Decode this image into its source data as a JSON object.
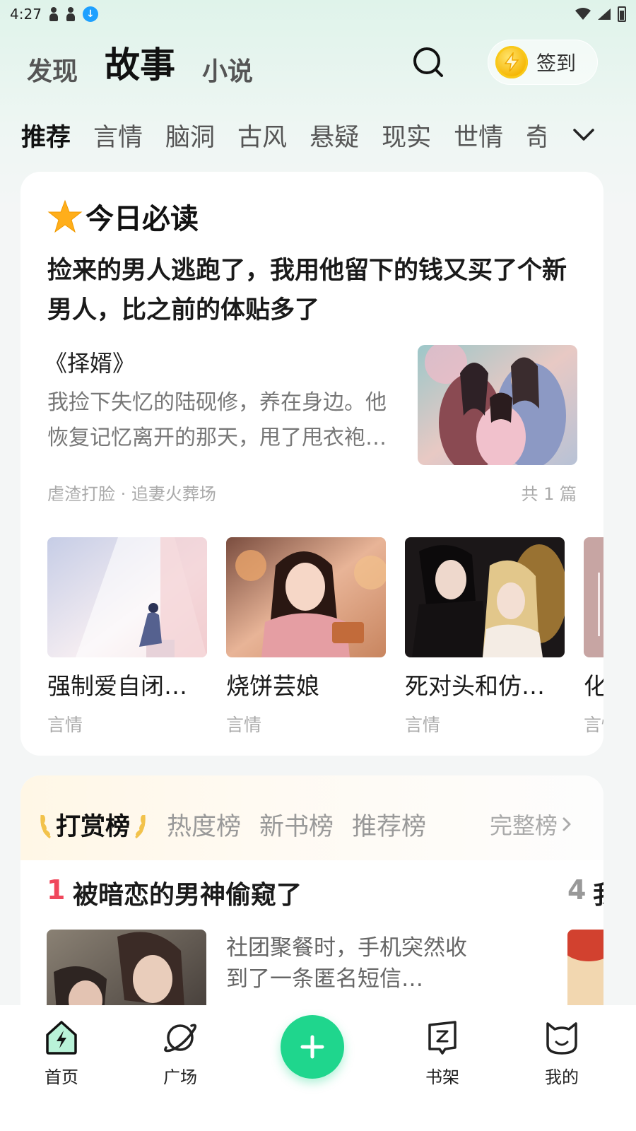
{
  "status_bar": {
    "time": "4:27",
    "download_glyph": "↓"
  },
  "top_nav": {
    "tabs": [
      {
        "label": "发现"
      },
      {
        "label": "故事"
      },
      {
        "label": "小说"
      }
    ],
    "active": 1,
    "checkin_label": "签到"
  },
  "categories": [
    "推荐",
    "言情",
    "脑洞",
    "古风",
    "悬疑",
    "现实",
    "世情",
    "奇幻"
  ],
  "today": {
    "title": "今日必读",
    "headline": "捡来的男人逃跑了，我用他留下的钱又买了个新男人，比之前的体贴多了",
    "book_title": "《择婿》",
    "summary": "我捡下失忆的陆砚修，养在身边。他恢复记忆离开的那天，甩了甩衣袍…",
    "tags": "虐渣打脸 · 追妻火葬场",
    "count": "共 1 篇"
  },
  "recommendations": [
    {
      "title": "强制爱自闭症…",
      "genre": "言情"
    },
    {
      "title": "烧饼芸娘",
      "genre": "言情"
    },
    {
      "title": "死对头和仿生…",
      "genre": "言情"
    },
    {
      "title": "化",
      "genre": "言情"
    }
  ],
  "ranking": {
    "tabs": [
      "打赏榜",
      "热度榜",
      "新书榜",
      "推荐榜"
    ],
    "full_label": "完整榜",
    "items": [
      {
        "rank": "1",
        "title": "被暗恋的男神偷窥了",
        "summary": "社团聚餐时，手机突然收到了一条匿名短信…"
      },
      {
        "rank": "4",
        "title": "我"
      }
    ]
  },
  "bottom_nav": [
    {
      "label": "首页",
      "icon": "home-bolt-icon"
    },
    {
      "label": "广场",
      "icon": "planet-icon"
    },
    {
      "label": "书架",
      "icon": "bookshelf-icon"
    },
    {
      "label": "我的",
      "icon": "profile-cat-icon"
    }
  ],
  "colors": {
    "accent": "#1fd68d",
    "rank_red": "#f0475c",
    "coin": "#f5b400"
  }
}
